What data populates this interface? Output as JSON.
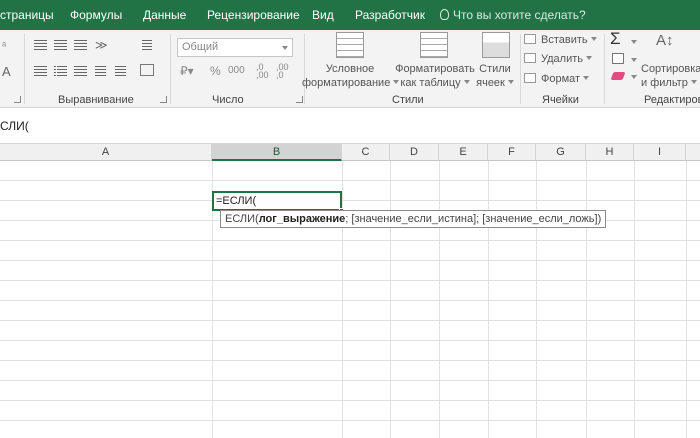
{
  "tabs": [
    "страницы",
    "Формулы",
    "Данные",
    "Рецензирование",
    "Вид",
    "Разработчик"
  ],
  "tell_me": "Что вы хотите сделать?",
  "groups": {
    "alignment": "Выравнивание",
    "number": "Число",
    "styles": "Стили",
    "cells": "Ячейки",
    "editing": "Редактирова"
  },
  "number_format": "Общий",
  "number_buttons": {
    "percent": "%",
    "thousands": "000"
  },
  "styles_buttons": {
    "conditional": [
      "Условное",
      "форматирование"
    ],
    "as_table": [
      "Форматировать",
      "как таблицу"
    ],
    "cell_styles": [
      "Стили",
      "ячеек"
    ]
  },
  "cells_buttons": {
    "insert": "Вставить",
    "delete": "Удалить",
    "format": "Формат"
  },
  "editing_buttons": {
    "sort": [
      "Сортировка",
      "и фильтр"
    ]
  },
  "formula_bar_text": "СЛИ(",
  "columns": [
    "A",
    "B",
    "C",
    "D",
    "E",
    "F",
    "G",
    "H",
    "I"
  ],
  "active_cell_content": "=ЕСЛИ(",
  "tooltip": {
    "func": "ЕСЛИ(",
    "arg1": "лог_выражение",
    "rest": "; [значение_если_истина]; [значение_если_ложь])"
  }
}
